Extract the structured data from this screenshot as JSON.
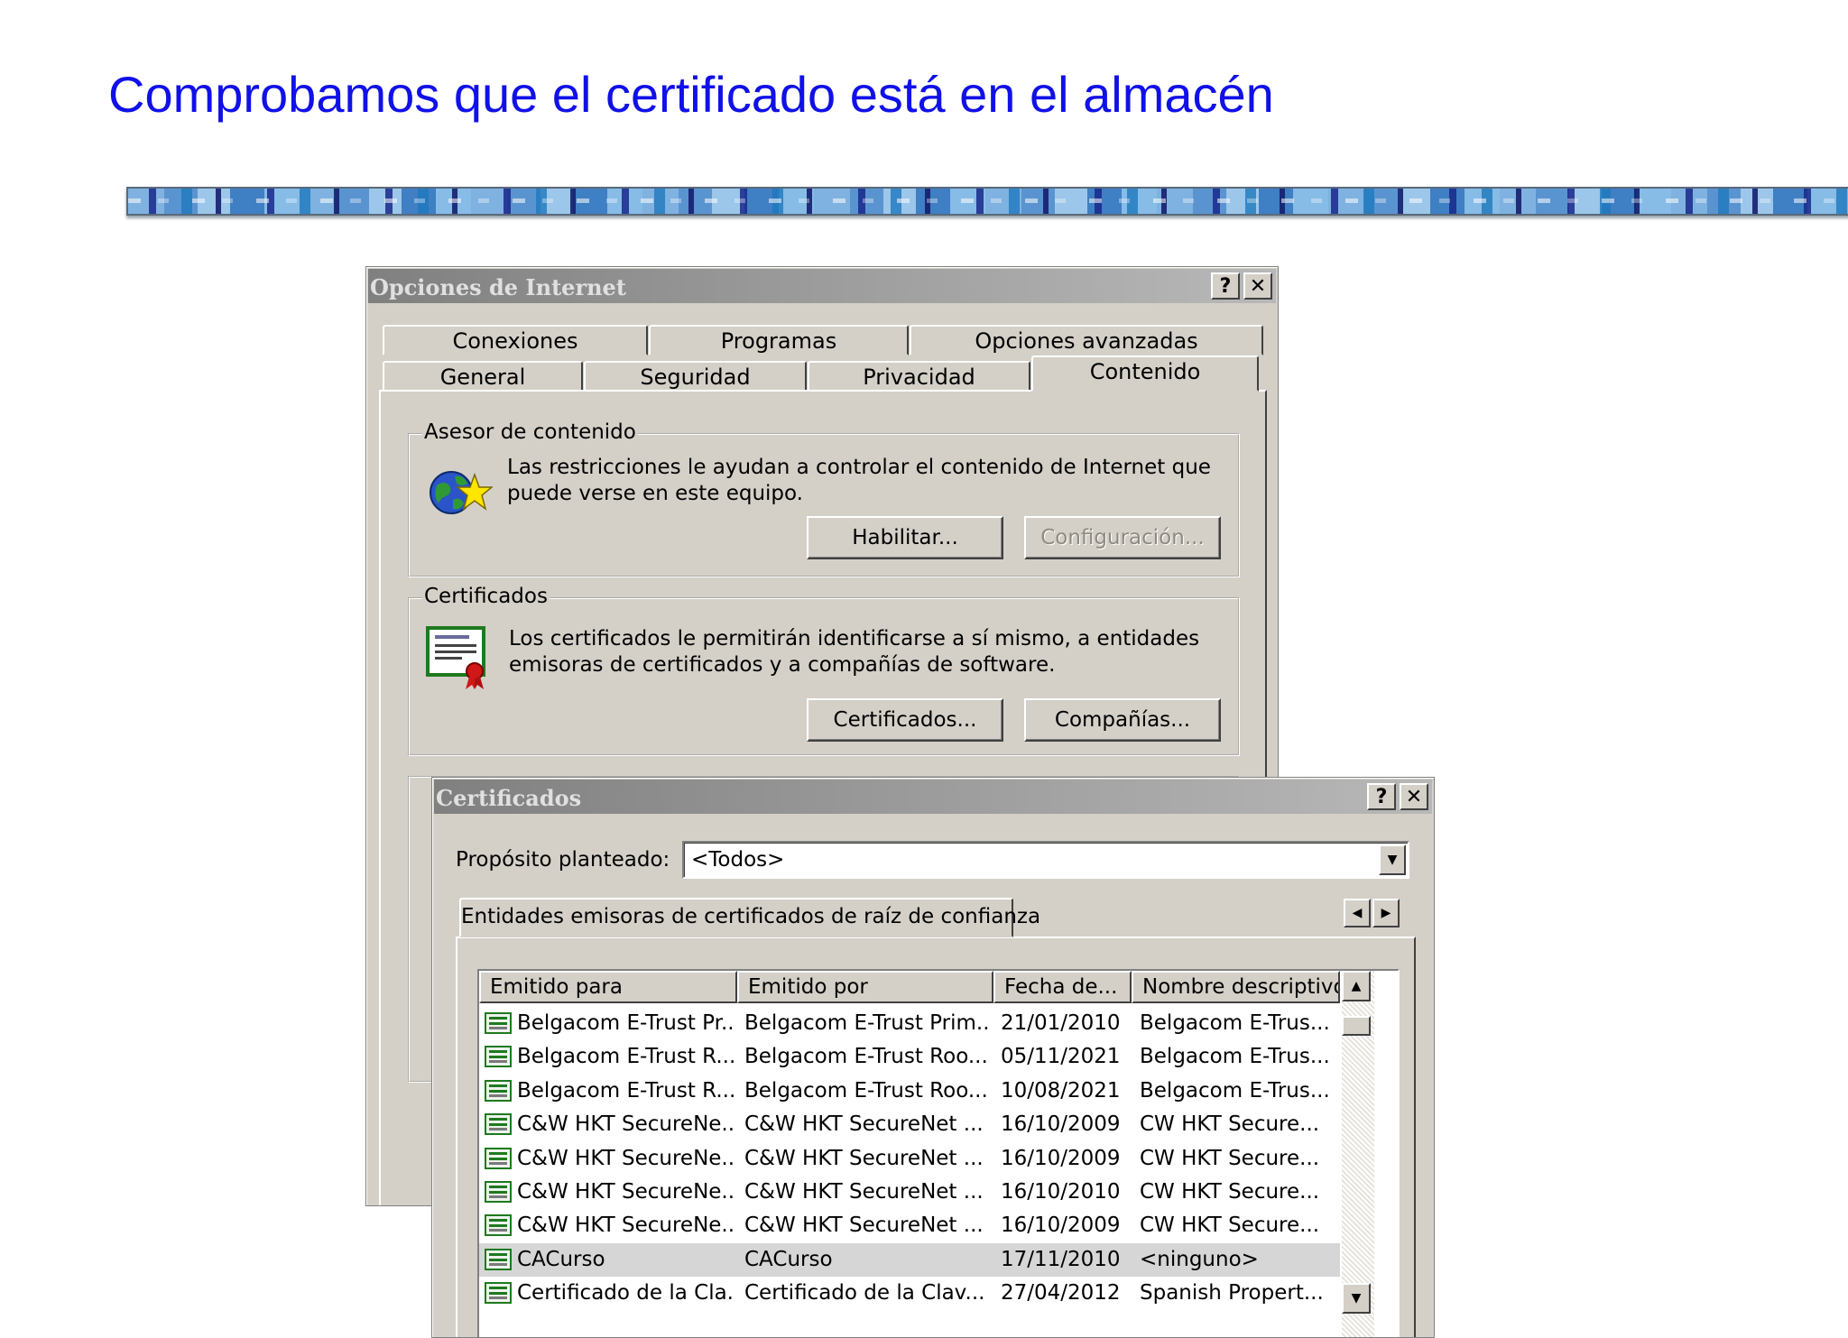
{
  "slide": {
    "title": "Comprobamos que el certificado está en el almacén"
  },
  "internet_options": {
    "title": "Opciones de Internet",
    "help_glyph": "?",
    "close_glyph": "✕",
    "tabs_back": [
      "Conexiones",
      "Programas",
      "Opciones avanzadas"
    ],
    "tabs_front": [
      "General",
      "Seguridad",
      "Privacidad",
      "Contenido"
    ],
    "active_tab": "Contenido",
    "content_advisor": {
      "label": "Asesor de contenido",
      "icon": "globe-star-icon",
      "text": "Las restricciones le ayudan a controlar el contenido de Internet que puede verse en este equipo.",
      "enable_button": "Habilitar...",
      "settings_button": "Configuración..."
    },
    "certificates": {
      "label": "Certificados",
      "icon": "certificate-icon",
      "text": "Los certificados le permitirán identificarse a sí mismo, a entidades emisoras de certificados y a compañías de software.",
      "certificates_button": "Certificados...",
      "publishers_button": "Compañías..."
    }
  },
  "certificates_dialog": {
    "title": "Certificados",
    "help_glyph": "?",
    "close_glyph": "✕",
    "purpose_label": "Propósito planteado:",
    "purpose_value": "<Todos>",
    "tab": "Entidades emisoras de certificados de raíz de confianza",
    "columns": [
      "Emitido para",
      "Emitido por",
      "Fecha de...",
      "Nombre descriptivo"
    ],
    "rows": [
      {
        "issued_to": "Belgacom E-Trust Pr...",
        "issued_by": "Belgacom E-Trust Prim...",
        "date": "21/01/2010",
        "friendly": "Belgacom E-Trus..."
      },
      {
        "issued_to": "Belgacom E-Trust R...",
        "issued_by": "Belgacom E-Trust Roo...",
        "date": "05/11/2021",
        "friendly": "Belgacom E-Trus..."
      },
      {
        "issued_to": "Belgacom E-Trust R...",
        "issued_by": "Belgacom E-Trust Roo...",
        "date": "10/08/2021",
        "friendly": "Belgacom E-Trus..."
      },
      {
        "issued_to": "C&W HKT SecureNe...",
        "issued_by": "C&W HKT SecureNet ...",
        "date": "16/10/2009",
        "friendly": "CW HKT Secure..."
      },
      {
        "issued_to": "C&W HKT SecureNe...",
        "issued_by": "C&W HKT SecureNet ...",
        "date": "16/10/2009",
        "friendly": "CW HKT Secure..."
      },
      {
        "issued_to": "C&W HKT SecureNe...",
        "issued_by": "C&W HKT SecureNet ...",
        "date": "16/10/2010",
        "friendly": "CW HKT Secure..."
      },
      {
        "issued_to": "C&W HKT SecureNe...",
        "issued_by": "C&W HKT SecureNet ...",
        "date": "16/10/2009",
        "friendly": "CW HKT Secure..."
      },
      {
        "issued_to": "CACurso",
        "issued_by": "CACurso",
        "date": "17/11/2010",
        "friendly": "<ninguno>",
        "selected": true
      },
      {
        "issued_to": "Certificado de la Cla...",
        "issued_by": "Certificado de la Clav...",
        "date": "27/04/2012",
        "friendly": "Spanish Propert..."
      }
    ]
  },
  "colors": {
    "title_blue": "#1010e8",
    "dialog_face": "#d4d0c8",
    "cert_green": "#1e7a1e"
  }
}
